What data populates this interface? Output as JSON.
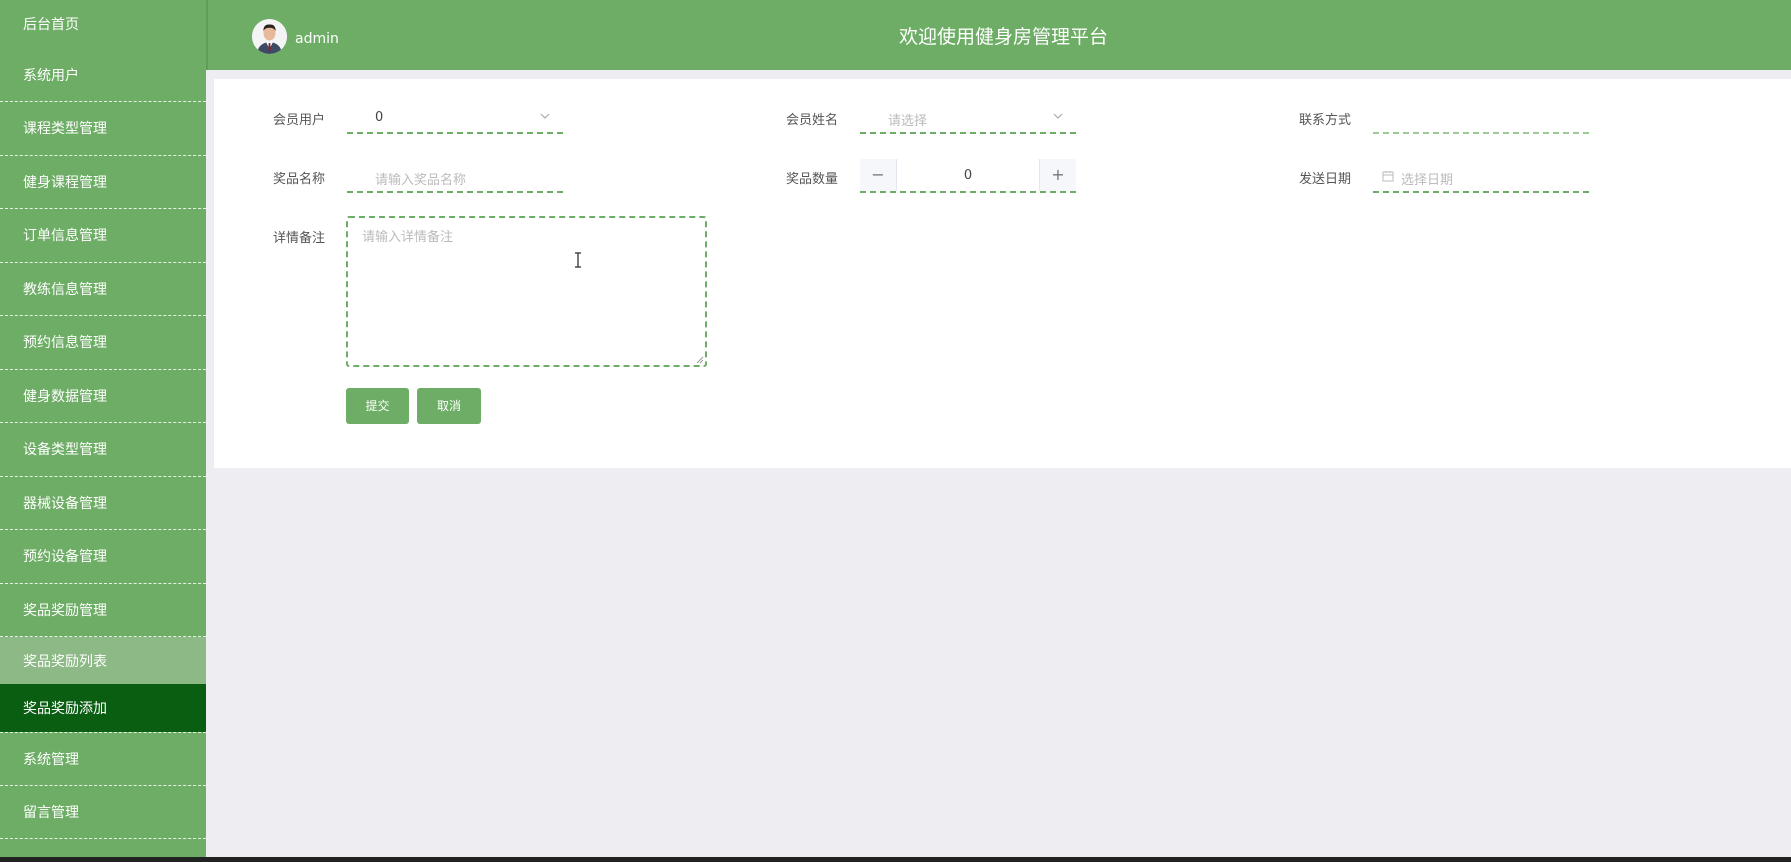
{
  "sidebar": {
    "items": [
      {
        "label": "后台首页"
      },
      {
        "label": "系统用户"
      },
      {
        "label": "课程类型管理"
      },
      {
        "label": "健身课程管理"
      },
      {
        "label": "订单信息管理"
      },
      {
        "label": "教练信息管理"
      },
      {
        "label": "预约信息管理"
      },
      {
        "label": "健身数据管理"
      },
      {
        "label": "设备类型管理"
      },
      {
        "label": "器械设备管理"
      },
      {
        "label": "预约设备管理"
      },
      {
        "label": "奖品奖励管理"
      },
      {
        "label": "奖品奖励列表"
      },
      {
        "label": "奖品奖励添加"
      },
      {
        "label": "系统管理"
      },
      {
        "label": "留言管理"
      }
    ]
  },
  "header": {
    "username": "admin",
    "title": "欢迎使用健身房管理平台"
  },
  "form": {
    "member_user": {
      "label": "会员用户",
      "value": "0"
    },
    "member_name": {
      "label": "会员姓名",
      "placeholder": "请选择"
    },
    "contact": {
      "label": "联系方式",
      "value": ""
    },
    "prize_name": {
      "label": "奖品名称",
      "placeholder": "请输入奖品名称"
    },
    "prize_qty": {
      "label": "奖品数量",
      "value": "0",
      "minus": "−",
      "plus": "+"
    },
    "send_date": {
      "label": "发送日期",
      "placeholder": "选择日期"
    },
    "remarks": {
      "label": "详情备注",
      "placeholder": "请输入详情备注"
    },
    "submit": "提交",
    "cancel": "取消"
  },
  "colors": {
    "primary": "#6dad65",
    "active": "#0a5e12",
    "sub_active": "#8cb985",
    "background": "#eeeef2"
  }
}
